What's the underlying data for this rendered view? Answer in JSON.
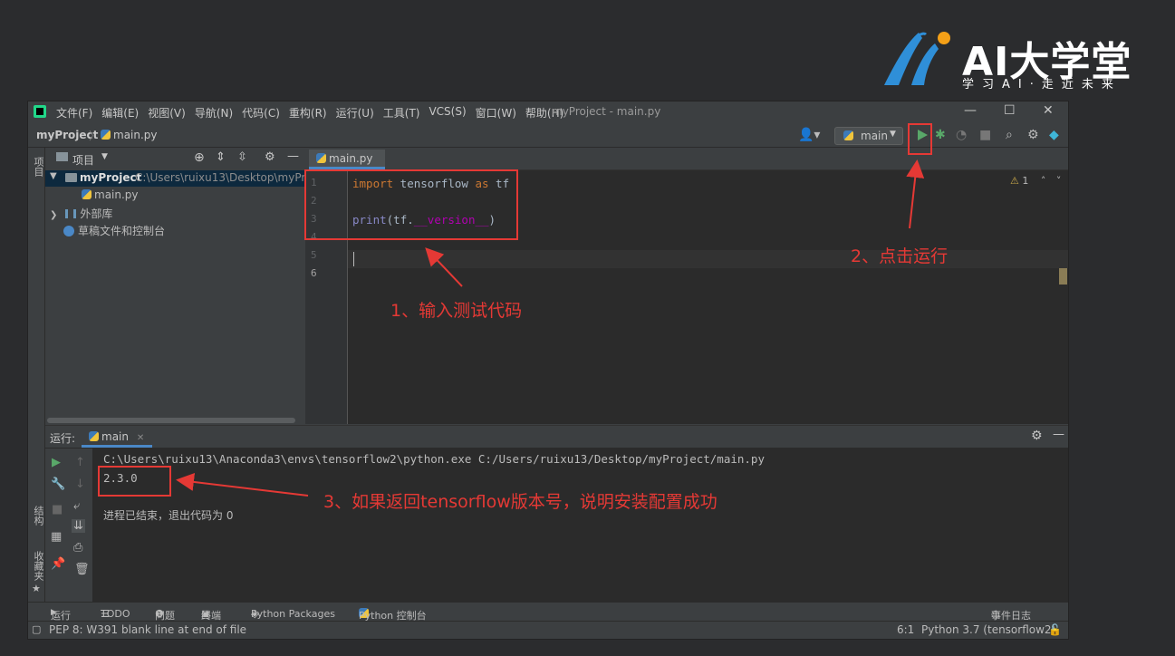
{
  "brand": {
    "title": "AI大学堂",
    "slogan": "学习AI·走近未来"
  },
  "menubar": {
    "items": [
      "文件(F)",
      "编辑(E)",
      "视图(V)",
      "导航(N)",
      "代码(C)",
      "重构(R)",
      "运行(U)",
      "工具(T)",
      "VCS(S)",
      "窗口(W)",
      "帮助(H)"
    ],
    "window_title": "myProject - main.py"
  },
  "navbar": {
    "project": "myProject",
    "file": "main.py",
    "run_config": "main"
  },
  "left_stripe": {
    "project_label": "项目",
    "structure_label": "结构",
    "favorites_label": "收藏夹"
  },
  "project_panel": {
    "header": "项目",
    "tree": [
      {
        "label": "myProject",
        "path": "C:\\Users\\ruixu13\\Desktop\\myProject"
      },
      {
        "label": "main.py"
      },
      {
        "label": "外部库"
      },
      {
        "label": "草稿文件和控制台"
      }
    ]
  },
  "editor": {
    "tab": "main.py",
    "line_numbers": [
      "1",
      "2",
      "3",
      "4",
      "5",
      "6"
    ],
    "code": {
      "line1_kw_import": "import",
      "line1_mod": " tensorflow ",
      "line1_kw_as": "as",
      "line1_alias": " tf",
      "line3_fn": "print",
      "line3_open": "(tf.",
      "line3_attr": "__version__",
      "line3_close": ")"
    },
    "warning_count": "1"
  },
  "run_panel": {
    "label": "运行:",
    "tab": "main",
    "command": "C:\\Users\\ruixu13\\Anaconda3\\envs\\tensorflow2\\python.exe C:/Users/ruixu13/Desktop/myProject/main.py",
    "output": "2.3.0",
    "exit_message": "进程已结束，退出代码为 0"
  },
  "bottom_tabs": {
    "run": "运行",
    "todo": "TODO",
    "problems": "问题",
    "terminal": "终端",
    "python_packages": "Python Packages",
    "python_console": "Python 控制台",
    "event_log": "事件日志"
  },
  "status_bar": {
    "message": "PEP 8: W391 blank line at end of file",
    "position": "6:1",
    "interpreter": "Python 3.7 (tensorflow2)"
  },
  "annotations": {
    "step1": "1、输入测试代码",
    "step2": "2、点击运行",
    "step3": "3、如果返回tensorflow版本号，说明安装配置成功"
  },
  "colors": {
    "annotation_red": "#e53935",
    "run_green": "#59a869",
    "keyword_orange": "#cc7832",
    "dunder_purple": "#b200b2"
  }
}
